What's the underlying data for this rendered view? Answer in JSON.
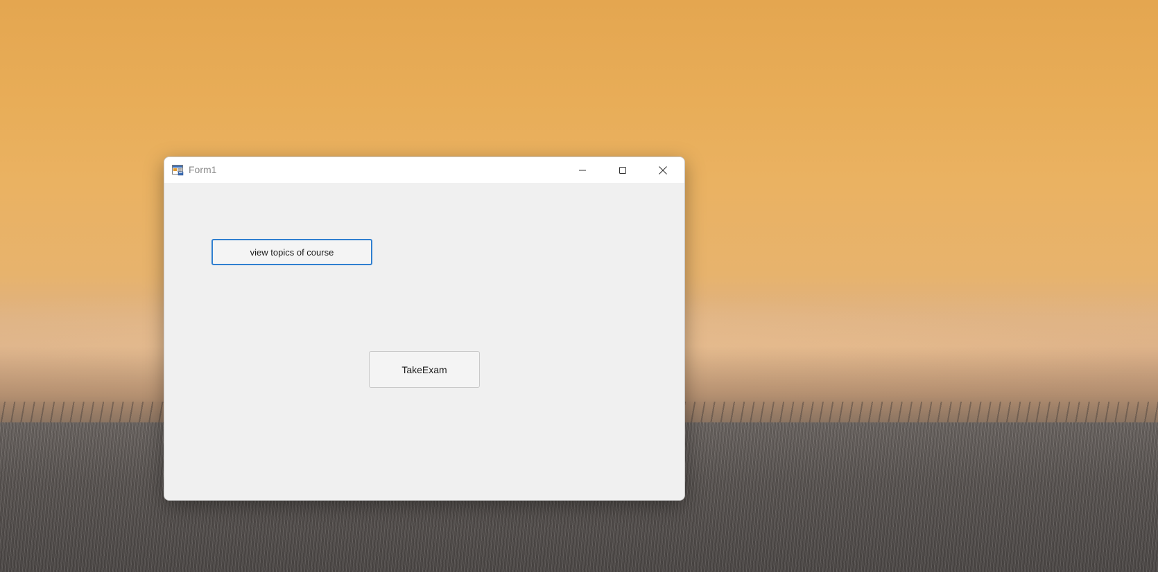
{
  "window": {
    "title": "Form1"
  },
  "titlebar": {
    "minimize_icon": "minimize-icon",
    "maximize_icon": "maximize-icon",
    "close_icon": "close-icon",
    "app_icon": "form-app-icon"
  },
  "form": {
    "view_topics_label": "view topics of course",
    "take_exam_label": "TakeExam"
  },
  "colors": {
    "focus_border": "#2f7fd0",
    "client_background": "#f0f0f0",
    "titlebar_background": "#ffffff"
  }
}
